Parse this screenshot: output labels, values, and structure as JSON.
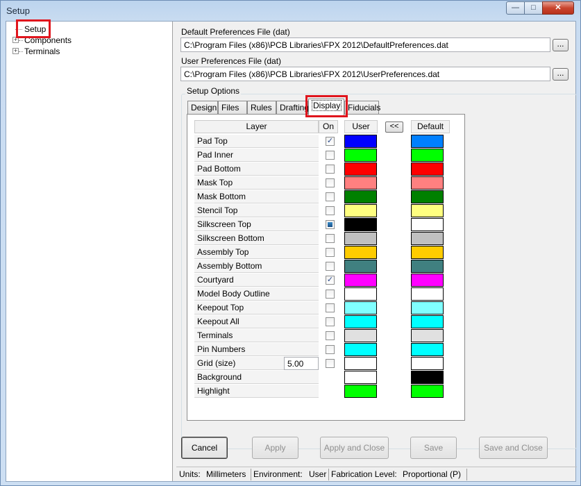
{
  "window": {
    "title": "Setup"
  },
  "tree": {
    "items": [
      {
        "label": "Setup",
        "expandable": false
      },
      {
        "label": "Components",
        "expandable": true,
        "expander": "+"
      },
      {
        "label": "Terminals",
        "expandable": true,
        "expander": "+"
      }
    ]
  },
  "prefs": {
    "default_label": "Default Preferences File  (dat)",
    "default_path": "C:\\Program Files (x86)\\PCB Libraries\\FPX 2012\\DefaultPreferences.dat",
    "user_label": "User Preferences File  (dat)",
    "user_path": "C:\\Program Files (x86)\\PCB Libraries\\FPX 2012\\UserPreferences.dat",
    "browse_label": "..."
  },
  "options": {
    "title": "Setup Options",
    "tabs": [
      "Design",
      "Files",
      "Rules",
      "Drafting",
      "Display",
      "Fiducials"
    ],
    "active_tab": "Display"
  },
  "display": {
    "headers": {
      "layer": "Layer",
      "on": "On",
      "user": "User",
      "default": "Default"
    },
    "copy_button": "<<",
    "grid_size": "5.00",
    "layers": [
      {
        "name": "Pad Top",
        "on": "checked",
        "user": "#0000ff",
        "default": "#0080ff"
      },
      {
        "name": "Pad Inner",
        "on": "unchecked",
        "user": "#00ff00",
        "default": "#00ff00"
      },
      {
        "name": "Pad Bottom",
        "on": "unchecked",
        "user": "#ff0000",
        "default": "#ff0000"
      },
      {
        "name": "Mask Top",
        "on": "unchecked",
        "user": "#ff8080",
        "default": "#ff8080"
      },
      {
        "name": "Mask Bottom",
        "on": "unchecked",
        "user": "#008000",
        "default": "#008000"
      },
      {
        "name": "Stencil Top",
        "on": "unchecked",
        "user": "#ffff80",
        "default": "#ffff80"
      },
      {
        "name": "Silkscreen Top",
        "on": "indeterminate",
        "user": "#000000",
        "default": "#ffffff"
      },
      {
        "name": "Silkscreen Bottom",
        "on": "unchecked",
        "user": "#c0c0c0",
        "default": "#c0c0c0"
      },
      {
        "name": "Assembly Top",
        "on": "unchecked",
        "user": "#ffcc00",
        "default": "#ffcc00"
      },
      {
        "name": "Assembly Bottom",
        "on": "unchecked",
        "user": "#408080",
        "default": "#408080"
      },
      {
        "name": "Courtyard",
        "on": "checked",
        "user": "#ff00ff",
        "default": "#ff00ff"
      },
      {
        "name": "Model Body Outline",
        "on": "unchecked",
        "user": "#ffffff",
        "default": "#ffffff"
      },
      {
        "name": "Keepout Top",
        "on": "unchecked",
        "user": "#80ffff",
        "default": "#80ffff"
      },
      {
        "name": "Keepout All",
        "on": "unchecked",
        "user": "#00ffff",
        "default": "#00ffff"
      },
      {
        "name": "Terminals",
        "on": "unchecked",
        "user": "#e0e0e0",
        "default": "#e0e0e0"
      },
      {
        "name": "Pin Numbers",
        "on": "unchecked",
        "user": "#00ffff",
        "default": "#00ffff"
      },
      {
        "name": "Grid (size)",
        "on": "unchecked",
        "user": "#ffffff",
        "default": "#ffffff"
      },
      {
        "name": "Background",
        "on": "none",
        "user": "#ffffff",
        "default": "#000000"
      },
      {
        "name": "Highlight",
        "on": "none",
        "user": "#00ff00",
        "default": "#00ff00"
      }
    ]
  },
  "buttons": {
    "cancel": "Cancel",
    "apply": "Apply",
    "apply_close": "Apply and Close",
    "save": "Save",
    "save_close": "Save and Close"
  },
  "status": {
    "units_label": "Units:",
    "units_value": "Millimeters",
    "env_label": "Environment:",
    "env_value": "User",
    "fab_label": "Fabrication Level:",
    "fab_value": "Proportional (P)"
  },
  "colors": {
    "highlight_box": "#e0151d"
  }
}
